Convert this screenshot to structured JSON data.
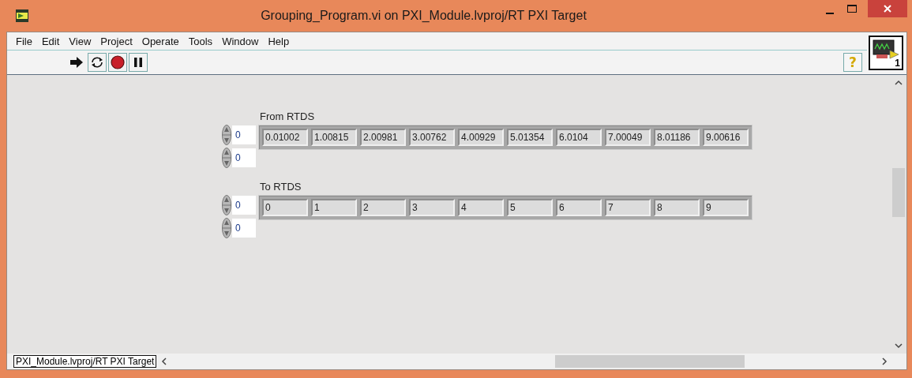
{
  "window": {
    "title": "Grouping_Program.vi on PXI_Module.lvproj/RT PXI Target"
  },
  "menu": [
    "File",
    "Edit",
    "View",
    "Project",
    "Operate",
    "Tools",
    "Window",
    "Help"
  ],
  "toolbar": {
    "help_button": "?"
  },
  "vi_icon": {
    "number": "1"
  },
  "arrays": [
    {
      "label": "From RTDS",
      "indices": [
        "0",
        "0"
      ],
      "values": [
        "0.01002",
        "1.00815",
        "2.00981",
        "3.00762",
        "4.00929",
        "5.01354",
        "6.0104",
        "7.00049",
        "8.01186",
        "9.00616"
      ]
    },
    {
      "label": "To RTDS",
      "indices": [
        "0",
        "0"
      ],
      "values": [
        "0",
        "1",
        "2",
        "3",
        "4",
        "5",
        "6",
        "7",
        "8",
        "9"
      ]
    }
  ],
  "status_bar": {
    "target": "PXI_Module.lvproj/RT PXI Target"
  }
}
